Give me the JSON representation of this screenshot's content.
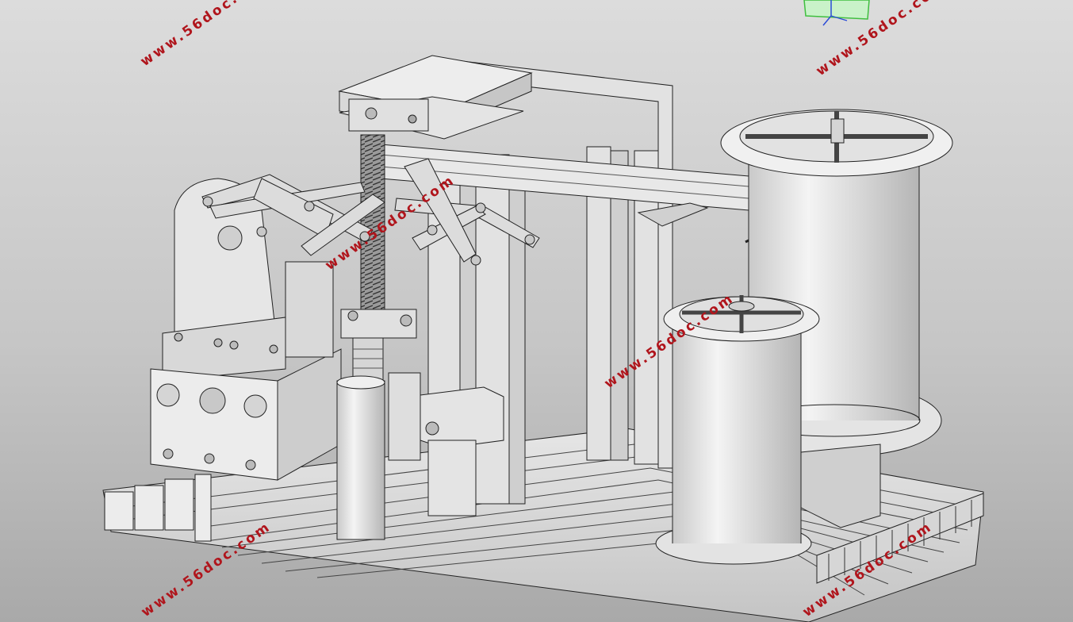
{
  "viewport": {
    "background_top": "#dcdcdc",
    "background_bottom": "#a9a9a9"
  },
  "model": {
    "description_icon": "cad-assembly-model",
    "shade_color": "#d9d9d9",
    "edge_color": "#1a1a1a"
  },
  "watermarks": [
    {
      "text": "www.56doc.com"
    },
    {
      "text": "www.56doc.com"
    },
    {
      "text": "www.56doc.com"
    },
    {
      "text": "www.56doc.com"
    },
    {
      "text": "www.56doc.com"
    },
    {
      "text": "www.56doc.com"
    }
  ],
  "triad": {
    "icon": "view-orientation-triad-icon",
    "plane_color": "#3fbf3f",
    "axis_color": "#2a4bd7"
  }
}
